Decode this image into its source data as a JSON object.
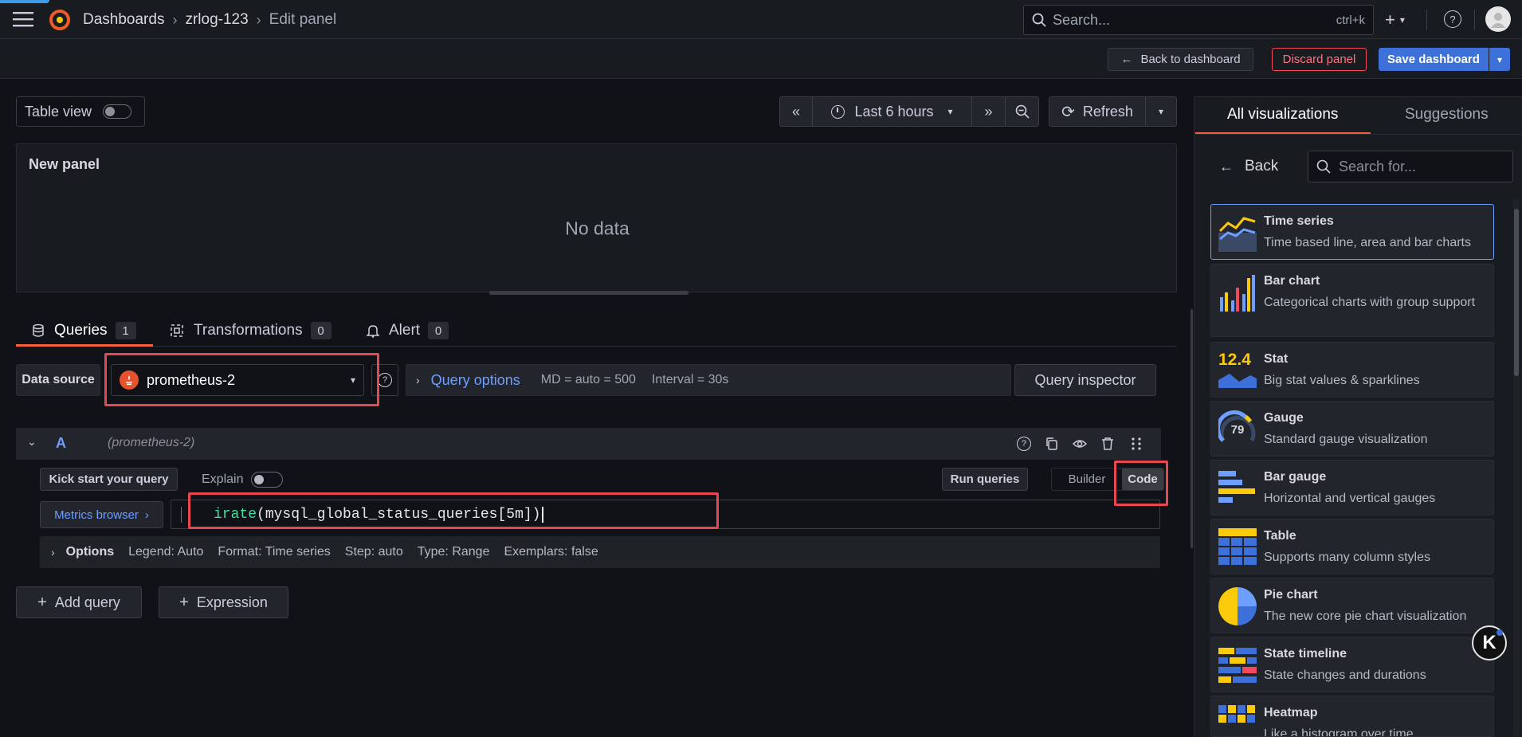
{
  "topbar": {
    "breadcrumbs": [
      "Dashboards",
      "zrlog-123",
      "Edit panel"
    ],
    "search_placeholder": "Search...",
    "search_shortcut": "ctrl+k"
  },
  "toolbar": {
    "back_label": "Back to dashboard",
    "discard_label": "Discard panel",
    "save_label": "Save dashboard"
  },
  "panel_controls": {
    "table_view_label": "Table view",
    "time_range": "Last 6 hours",
    "refresh_label": "Refresh"
  },
  "preview": {
    "title": "New panel",
    "empty_text": "No data"
  },
  "tabs": [
    {
      "label": "Queries",
      "count": "1"
    },
    {
      "label": "Transformations",
      "count": "0"
    },
    {
      "label": "Alert",
      "count": "0"
    }
  ],
  "datasource": {
    "label": "Data source",
    "selected": "prometheus-2",
    "query_options_label": "Query options",
    "md_info": "MD = auto = 500",
    "interval_info": "Interval = 30s",
    "inspector_label": "Query inspector"
  },
  "query": {
    "ref_id": "A",
    "datasource_name": "(prometheus-2)",
    "kickstart_label": "Kick start your query",
    "explain_label": "Explain",
    "run_label": "Run queries",
    "builder_label": "Builder",
    "code_label": "Code",
    "metrics_browser_label": "Metrics browser",
    "expr_func": "irate",
    "expr_rest": "(mysql_global_status_queries[5m])",
    "options_label": "Options",
    "options_items": [
      "Legend: Auto",
      "Format: Time series",
      "Step: auto",
      "Type: Range",
      "Exemplars: false"
    ]
  },
  "actions": {
    "add_query_label": "Add query",
    "expression_label": "Expression"
  },
  "viz_panel": {
    "tab_all": "All visualizations",
    "tab_suggestions": "Suggestions",
    "back_label": "Back",
    "search_placeholder": "Search for...",
    "items": [
      {
        "title": "Time series",
        "desc": "Time based line, area and bar charts"
      },
      {
        "title": "Bar chart",
        "desc": "Categorical charts with group support"
      },
      {
        "title": "Stat",
        "desc": "Big stat values & sparklines",
        "icon_text": "12.4"
      },
      {
        "title": "Gauge",
        "desc": "Standard gauge visualization",
        "icon_text": "79"
      },
      {
        "title": "Bar gauge",
        "desc": "Horizontal and vertical gauges"
      },
      {
        "title": "Table",
        "desc": "Supports many column styles"
      },
      {
        "title": "Pie chart",
        "desc": "The new core pie chart visualization"
      },
      {
        "title": "State timeline",
        "desc": "State changes and durations"
      },
      {
        "title": "Heatmap",
        "desc": "Like a histogram over time"
      }
    ]
  },
  "floating_badge": "K",
  "colors": {
    "accent": "#3d71d9",
    "link": "#6e9fff",
    "danger": "#f2495c",
    "highlight_box": "#e8474d",
    "code_function": "#3ee0a2"
  }
}
